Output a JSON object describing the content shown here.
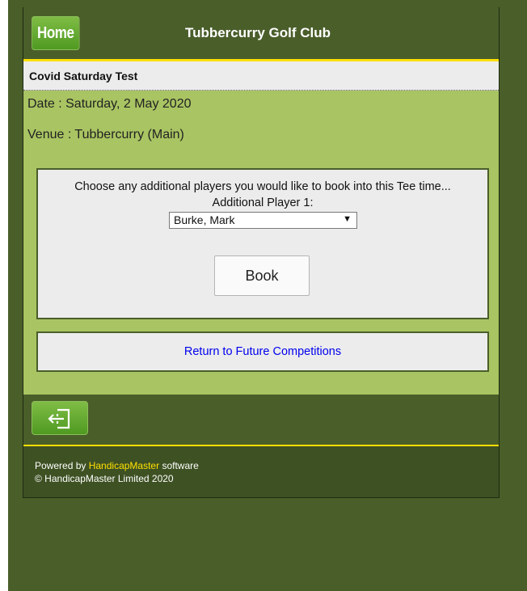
{
  "header": {
    "home_label": "Home",
    "site_title": "Tubbercurry Golf Club"
  },
  "competition": {
    "title": "Covid Saturday Test",
    "date": "Date : Saturday, 2 May 2020",
    "venue": "Venue : Tubbercurry (Main)"
  },
  "booking": {
    "prompt": "Choose any additional players you would like to book into this Tee time...",
    "player_label": "Additional Player 1:",
    "player_selected": "Burke, Mark",
    "book_label": "Book"
  },
  "nav": {
    "return_link": "Return to Future Competitions",
    "logout_icon": "logout-icon"
  },
  "footer": {
    "powered_prefix": "Powered by",
    "powered_brand": "HandicapMaster",
    "powered_suffix": "software",
    "copyright": "© HandicapMaster Limited 2020"
  },
  "colors": {
    "header_bg": "#4a5e2a",
    "accent_line": "#ffe000",
    "content_bg": "#a9c462",
    "button_green": "#5fa52e",
    "link_blue": "#0000ee"
  }
}
